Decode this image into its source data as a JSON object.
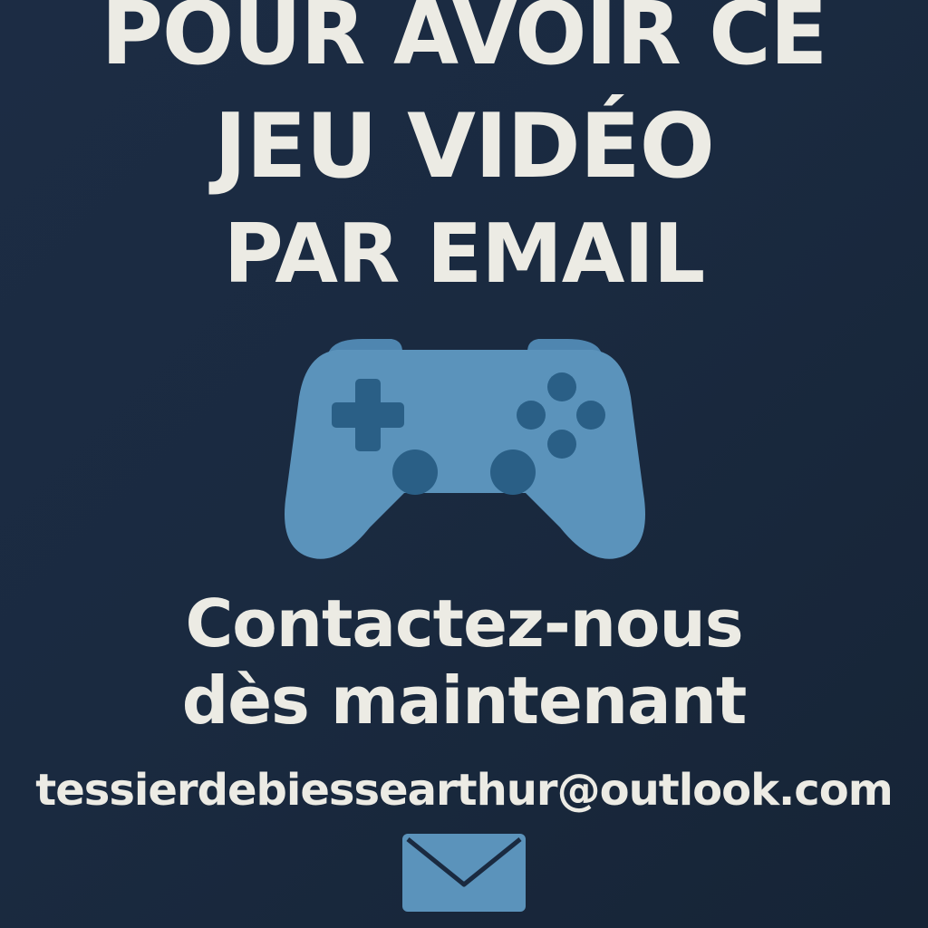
{
  "poster": {
    "headline_line1": "POUR AVOIR CE",
    "headline_line2": "JEU VIDÉO",
    "headline_line3": "PAR EMAIL",
    "subtitle_line1": "Contactez-nous",
    "subtitle_line2": "dès maintenant",
    "email": "tessierdebiessearthur@outlook.com"
  },
  "icons": {
    "controller": "gamepad-icon",
    "mail": "envelope-icon"
  },
  "colors": {
    "background": "#1a2a40",
    "text": "#ecebe4",
    "accent": "#5b93bb",
    "accent_dark": "#2a5f86"
  }
}
